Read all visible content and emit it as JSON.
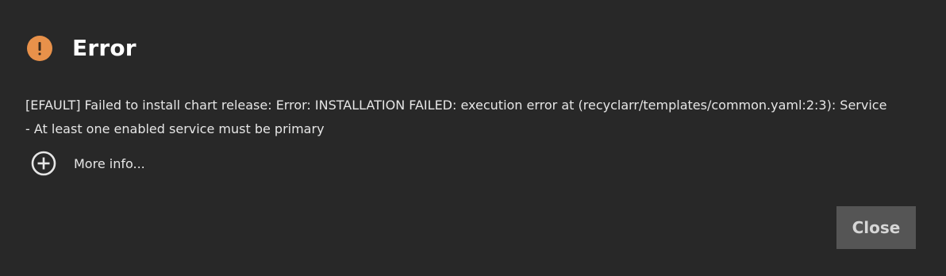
{
  "dialog": {
    "title": "Error",
    "message": "[EFAULT] Failed to install chart release: Error: INSTALLATION FAILED: execution error at (recyclarr/templates/common.yaml:2:3): Service\n- At least one enabled service must be primary",
    "more_info_label": "More info...",
    "close_label": "Close"
  },
  "icons": {
    "header": "alert-circle-icon",
    "more_info": "plus-circle-icon"
  },
  "colors": {
    "background": "#282828",
    "alert": "#e8914a",
    "button_bg": "#555555",
    "text": "#e6e6e6"
  }
}
